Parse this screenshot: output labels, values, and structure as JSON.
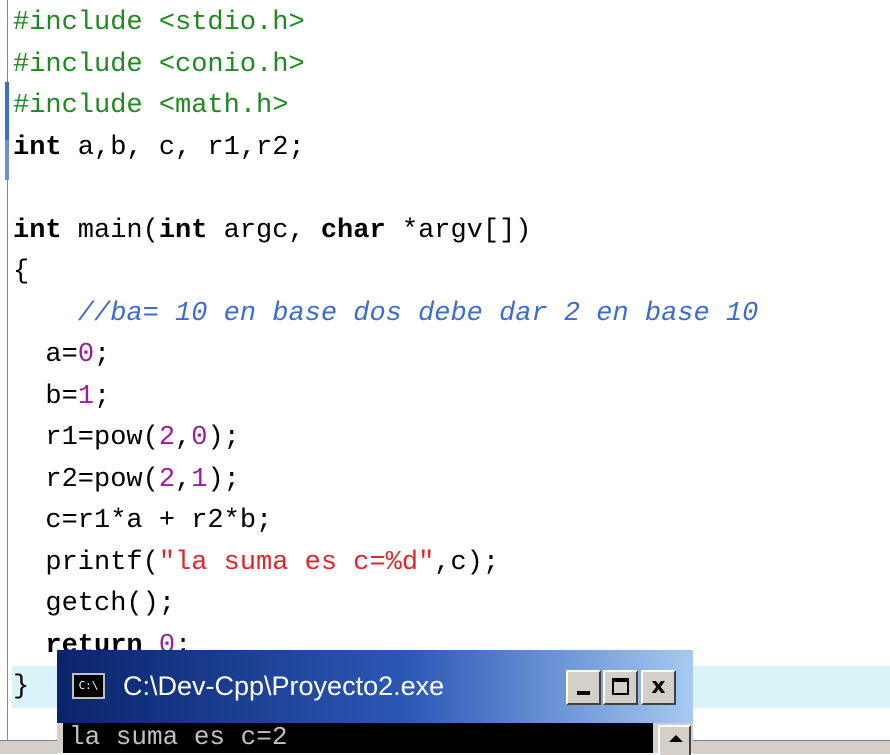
{
  "editor": {
    "lines": [
      {
        "segments": [
          {
            "cls": "pp",
            "text": "#include <stdio.h>"
          }
        ]
      },
      {
        "segments": [
          {
            "cls": "pp",
            "text": "#include <conio.h>"
          }
        ]
      },
      {
        "segments": [
          {
            "cls": "pp",
            "text": "#include <math.h>"
          }
        ]
      },
      {
        "segments": [
          {
            "cls": "kw",
            "text": "int"
          },
          {
            "cls": "",
            "text": " a,b, c, r1,r2;"
          }
        ]
      },
      {
        "segments": []
      },
      {
        "segments": [
          {
            "cls": "kw",
            "text": "int"
          },
          {
            "cls": "",
            "text": " main("
          },
          {
            "cls": "kw",
            "text": "int"
          },
          {
            "cls": "",
            "text": " argc, "
          },
          {
            "cls": "kw",
            "text": "char"
          },
          {
            "cls": "",
            "text": " *argv[])"
          }
        ]
      },
      {
        "segments": [
          {
            "cls": "",
            "text": "{"
          }
        ]
      },
      {
        "segments": [
          {
            "cls": "cmt",
            "text": "    //ba= 10 en base dos debe dar 2 en base 10"
          }
        ]
      },
      {
        "segments": [
          {
            "cls": "",
            "text": "  a="
          },
          {
            "cls": "num",
            "text": "0"
          },
          {
            "cls": "",
            "text": ";"
          }
        ]
      },
      {
        "segments": [
          {
            "cls": "",
            "text": "  b="
          },
          {
            "cls": "num",
            "text": "1"
          },
          {
            "cls": "",
            "text": ";"
          }
        ]
      },
      {
        "segments": [
          {
            "cls": "",
            "text": "  r1=pow("
          },
          {
            "cls": "num",
            "text": "2"
          },
          {
            "cls": "",
            "text": ","
          },
          {
            "cls": "num",
            "text": "0"
          },
          {
            "cls": "",
            "text": ");"
          }
        ]
      },
      {
        "segments": [
          {
            "cls": "",
            "text": "  r2=pow("
          },
          {
            "cls": "num",
            "text": "2"
          },
          {
            "cls": "",
            "text": ","
          },
          {
            "cls": "num",
            "text": "1"
          },
          {
            "cls": "",
            "text": ");"
          }
        ]
      },
      {
        "segments": [
          {
            "cls": "",
            "text": "  c=r1*a + r2*b;"
          }
        ]
      },
      {
        "segments": [
          {
            "cls": "",
            "text": "  printf("
          },
          {
            "cls": "str",
            "text": "\"la suma es c=%d\""
          },
          {
            "cls": "",
            "text": ",c);"
          }
        ]
      },
      {
        "segments": [
          {
            "cls": "",
            "text": "  getch();"
          }
        ]
      },
      {
        "segments": [
          {
            "cls": "kw",
            "text": "  return"
          },
          {
            "cls": "",
            "text": " "
          },
          {
            "cls": "num",
            "text": "0"
          },
          {
            "cls": "",
            "text": ";"
          }
        ]
      },
      {
        "segments": [
          {
            "cls": "",
            "text": "}"
          }
        ],
        "highlight": true
      }
    ]
  },
  "console": {
    "title": "C:\\Dev-Cpp\\Proyecto2.exe",
    "icon": "console-window-icon",
    "output": "la suma es c=2",
    "buttons": {
      "minimize": "minimize-icon",
      "maximize": "maximize-icon",
      "close": "x"
    }
  },
  "colors": {
    "preprocessor": "#1f8a1f",
    "number": "#9a1fa0",
    "string": "#e0262d",
    "comment": "#3c6ccf",
    "current_line": "#d9f3f9",
    "title_bar": "#0a246a"
  }
}
